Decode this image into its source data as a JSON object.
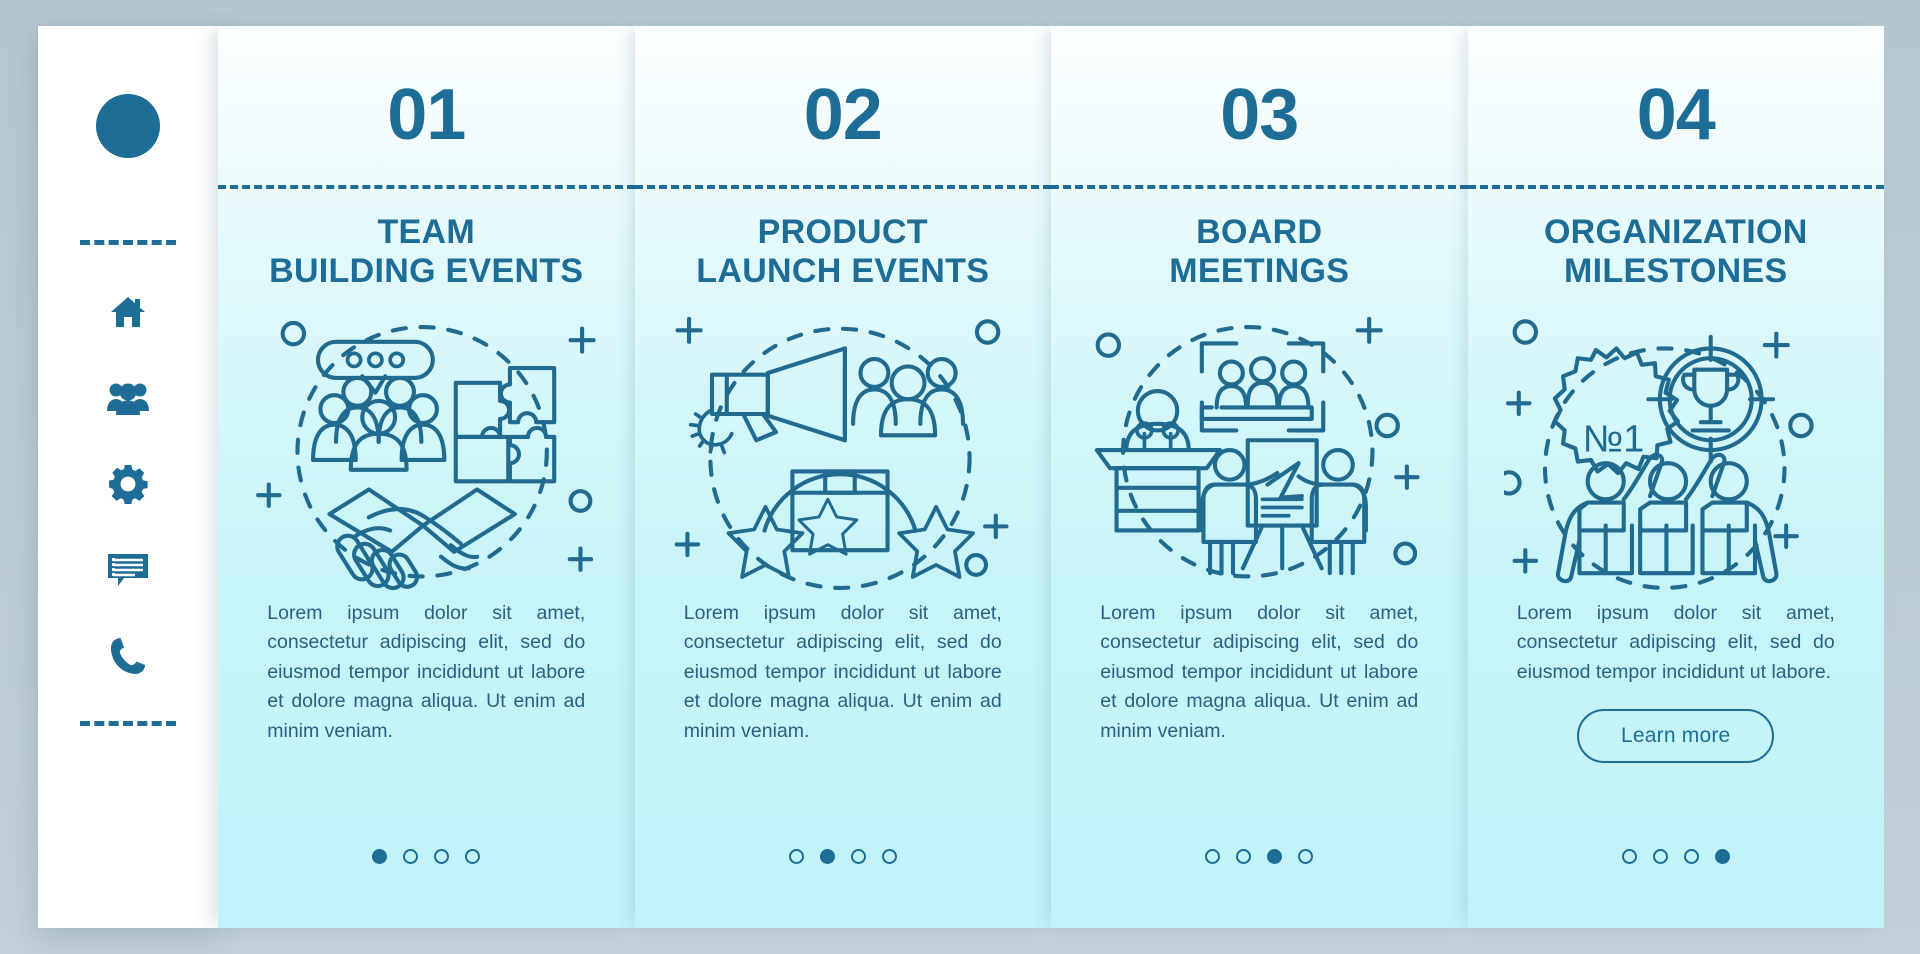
{
  "theme": {
    "accent": "#1e6d96",
    "card_bg_top": "#fbfeff",
    "card_bg_bottom": "#c0f3f8",
    "page_bg": "#bcccd4",
    "body_text": "#2a6180"
  },
  "sidebar": {
    "logo": "circle-logo",
    "icons": [
      {
        "name": "home-icon",
        "label": "Home"
      },
      {
        "name": "users-icon",
        "label": "Team"
      },
      {
        "name": "gear-icon",
        "label": "Settings"
      },
      {
        "name": "messages-icon",
        "label": "Messages"
      },
      {
        "name": "phone-icon",
        "label": "Contact"
      }
    ]
  },
  "cards": [
    {
      "number": "01",
      "title": "TEAM\nBUILDING EVENTS",
      "body": "Lorem ipsum dolor sit amet, consectetur adipiscing elit, sed do eiusmod tempor incididunt ut labore et dolore magna aliqua. Ut enim ad minim veniam.",
      "illustration": "team-building-illustration",
      "dots": 4,
      "active_dot": 1,
      "button": null
    },
    {
      "number": "02",
      "title": "PRODUCT\nLAUNCH EVENTS",
      "body": "Lorem ipsum dolor sit amet, consectetur adipiscing elit, sed do eiusmod tempor incididunt ut labore et dolore magna aliqua. Ut enim ad minim veniam.",
      "illustration": "product-launch-illustration",
      "dots": 4,
      "active_dot": 2,
      "button": null
    },
    {
      "number": "03",
      "title": "BOARD\nMEETINGS",
      "body": "Lorem ipsum dolor sit amet, consectetur adipiscing elit, sed do eiusmod tempor incididunt ut labore et dolore magna aliqua. Ut enim ad minim veniam.",
      "illustration": "board-meeting-illustration",
      "dots": 4,
      "active_dot": 3,
      "button": null
    },
    {
      "number": "04",
      "title": "ORGANIZATION\nMILESTONES",
      "body": "Lorem ipsum dolor sit amet, consectetur adipiscing elit, sed do eiusmod tempor incididunt ut labore.",
      "illustration": "milestones-illustration",
      "badge_text": "№1",
      "dots": 4,
      "active_dot": 4,
      "button": "Learn more"
    }
  ]
}
